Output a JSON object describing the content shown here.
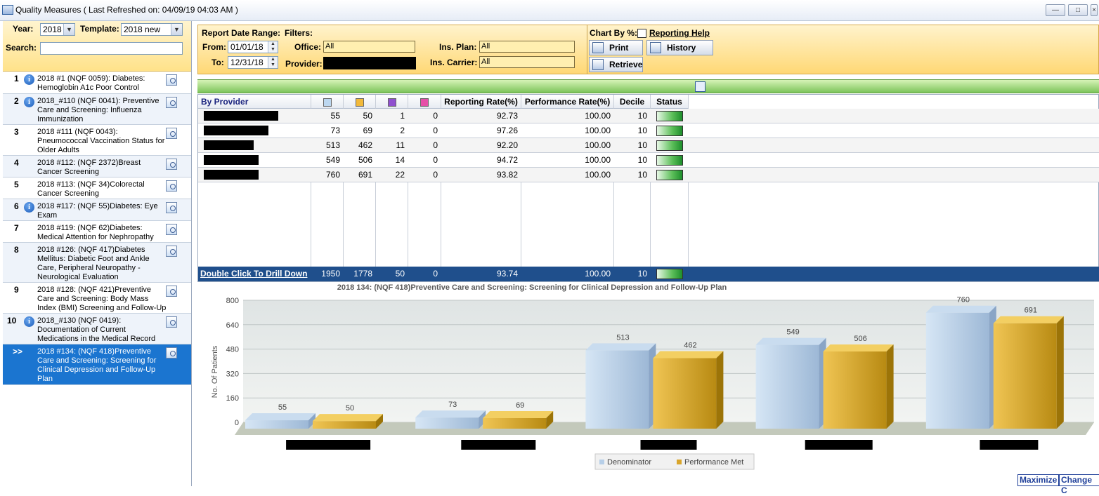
{
  "window": {
    "title": "Quality Measures ( Last Refreshed on: 04/09/19 04:03 AM )",
    "buttons": [
      "minimize",
      "restore",
      "close"
    ]
  },
  "left_panel": {
    "year_label": "Year:",
    "year_value": "2018",
    "template_label": "Template:",
    "template_value": "2018 new",
    "search_label": "Search:",
    "search_value": "",
    "measures": [
      {
        "num": "1",
        "info": true,
        "text": "2018 #1 (NQF 0059): Diabetes: Hemoglobin A1c Poor Control"
      },
      {
        "num": "2",
        "info": true,
        "text": "2018_#110 (NQF 0041): Preventive Care and Screening: Influenza Immunization"
      },
      {
        "num": "3",
        "info": false,
        "text": "2018 #111 (NQF 0043): Pneumococcal Vaccination Status for Older Adults"
      },
      {
        "num": "4",
        "info": false,
        "text": "2018 #112: (NQF 2372)Breast Cancer Screening"
      },
      {
        "num": "5",
        "info": false,
        "text": "2018 #113: (NQF 34)Colorectal Cancer Screening"
      },
      {
        "num": "6",
        "info": true,
        "text": "2018 #117: (NQF 55)Diabetes: Eye Exam"
      },
      {
        "num": "7",
        "info": false,
        "text": "2018 #119: (NQF 62)Diabetes: Medical Attention for Nephropathy"
      },
      {
        "num": "8",
        "info": false,
        "text": "2018 #126: (NQF 417)Diabetes Mellitus: Diabetic Foot and Ankle Care, Peripheral Neuropathy - Neurological Evaluation"
      },
      {
        "num": "9",
        "info": false,
        "text": "2018 #128: (NQF 421)Preventive Care and Screening: Body Mass Index (BMI) Screening and Follow-Up Plan"
      },
      {
        "num": "10",
        "info": true,
        "text": "2018_#130 (NQF 0419): Documentation of Current Medications in the Medical Record"
      },
      {
        "num": ">>",
        "info": false,
        "text": "2018 #134: (NQF 418)Preventive Care and Screening: Screening for Clinical Depression and Follow-Up Plan",
        "selected": true
      }
    ]
  },
  "filters": {
    "report_date_range_label": "Report Date Range:",
    "from_label": "From:",
    "from_value": "01/01/18",
    "to_label": "To:",
    "to_value": "12/31/18",
    "filters_label": "Filters:",
    "office_label": "Office:",
    "office_value": "All",
    "provider_label": "Provider:",
    "ins_plan_label": "Ins. Plan:",
    "ins_plan_value": "All",
    "ins_carrier_label": "Ins. Carrier:",
    "ins_carrier_value": "All",
    "chart_by_label": "Chart By %:",
    "reporting_help": "Reporting Help",
    "print": "Print",
    "history": "History",
    "retrieve": "Retrieve"
  },
  "grid": {
    "header": {
      "by_provider": "By Provider",
      "reporting_rate": "Reporting Rate(%)",
      "performance_rate": "Performance Rate(%)",
      "decile": "Decile",
      "status": "Status"
    },
    "legend_colors": [
      "#bcd7f0",
      "#f2b93a",
      "#8f4fcf",
      "#e64fa8"
    ],
    "rows": [
      {
        "c1": "55",
        "c2": "50",
        "c3": "1",
        "c4": "0",
        "rr": "92.73",
        "pr": "100.00",
        "decile": "10"
      },
      {
        "c1": "73",
        "c2": "69",
        "c3": "2",
        "c4": "0",
        "rr": "97.26",
        "pr": "100.00",
        "decile": "10"
      },
      {
        "c1": "513",
        "c2": "462",
        "c3": "11",
        "c4": "0",
        "rr": "92.20",
        "pr": "100.00",
        "decile": "10"
      },
      {
        "c1": "549",
        "c2": "506",
        "c3": "14",
        "c4": "0",
        "rr": "94.72",
        "pr": "100.00",
        "decile": "10"
      },
      {
        "c1": "760",
        "c2": "691",
        "c3": "22",
        "c4": "0",
        "rr": "93.82",
        "pr": "100.00",
        "decile": "10"
      }
    ],
    "total": {
      "label": "Double Click To Drill Down",
      "c1": "1950",
      "c2": "1778",
      "c3": "50",
      "c4": "0",
      "rr": "93.74",
      "pr": "100.00",
      "decile": "10"
    }
  },
  "chart_data": {
    "type": "bar",
    "title": "2018 134: (NQF 418)Preventive Care and Screening: Screening for Clinical Depression and Follow-Up Plan",
    "ylabel": "No. Of  Patients",
    "ylim": [
      0,
      800
    ],
    "yticks": [
      "0",
      "160",
      "320",
      "480",
      "640",
      "800"
    ],
    "categories": [
      "",
      "",
      "",
      "",
      ""
    ],
    "series": [
      {
        "name": "Denominator",
        "values": [
          55,
          73,
          513,
          549,
          760
        ],
        "color": "#b7cfe8"
      },
      {
        "name": "Performance Met",
        "values": [
          50,
          69,
          462,
          506,
          691
        ],
        "color": "#d9a52c"
      }
    ],
    "legend_position": "bottom"
  },
  "bottom": {
    "maximize": "Maximize",
    "change": "Change C"
  }
}
